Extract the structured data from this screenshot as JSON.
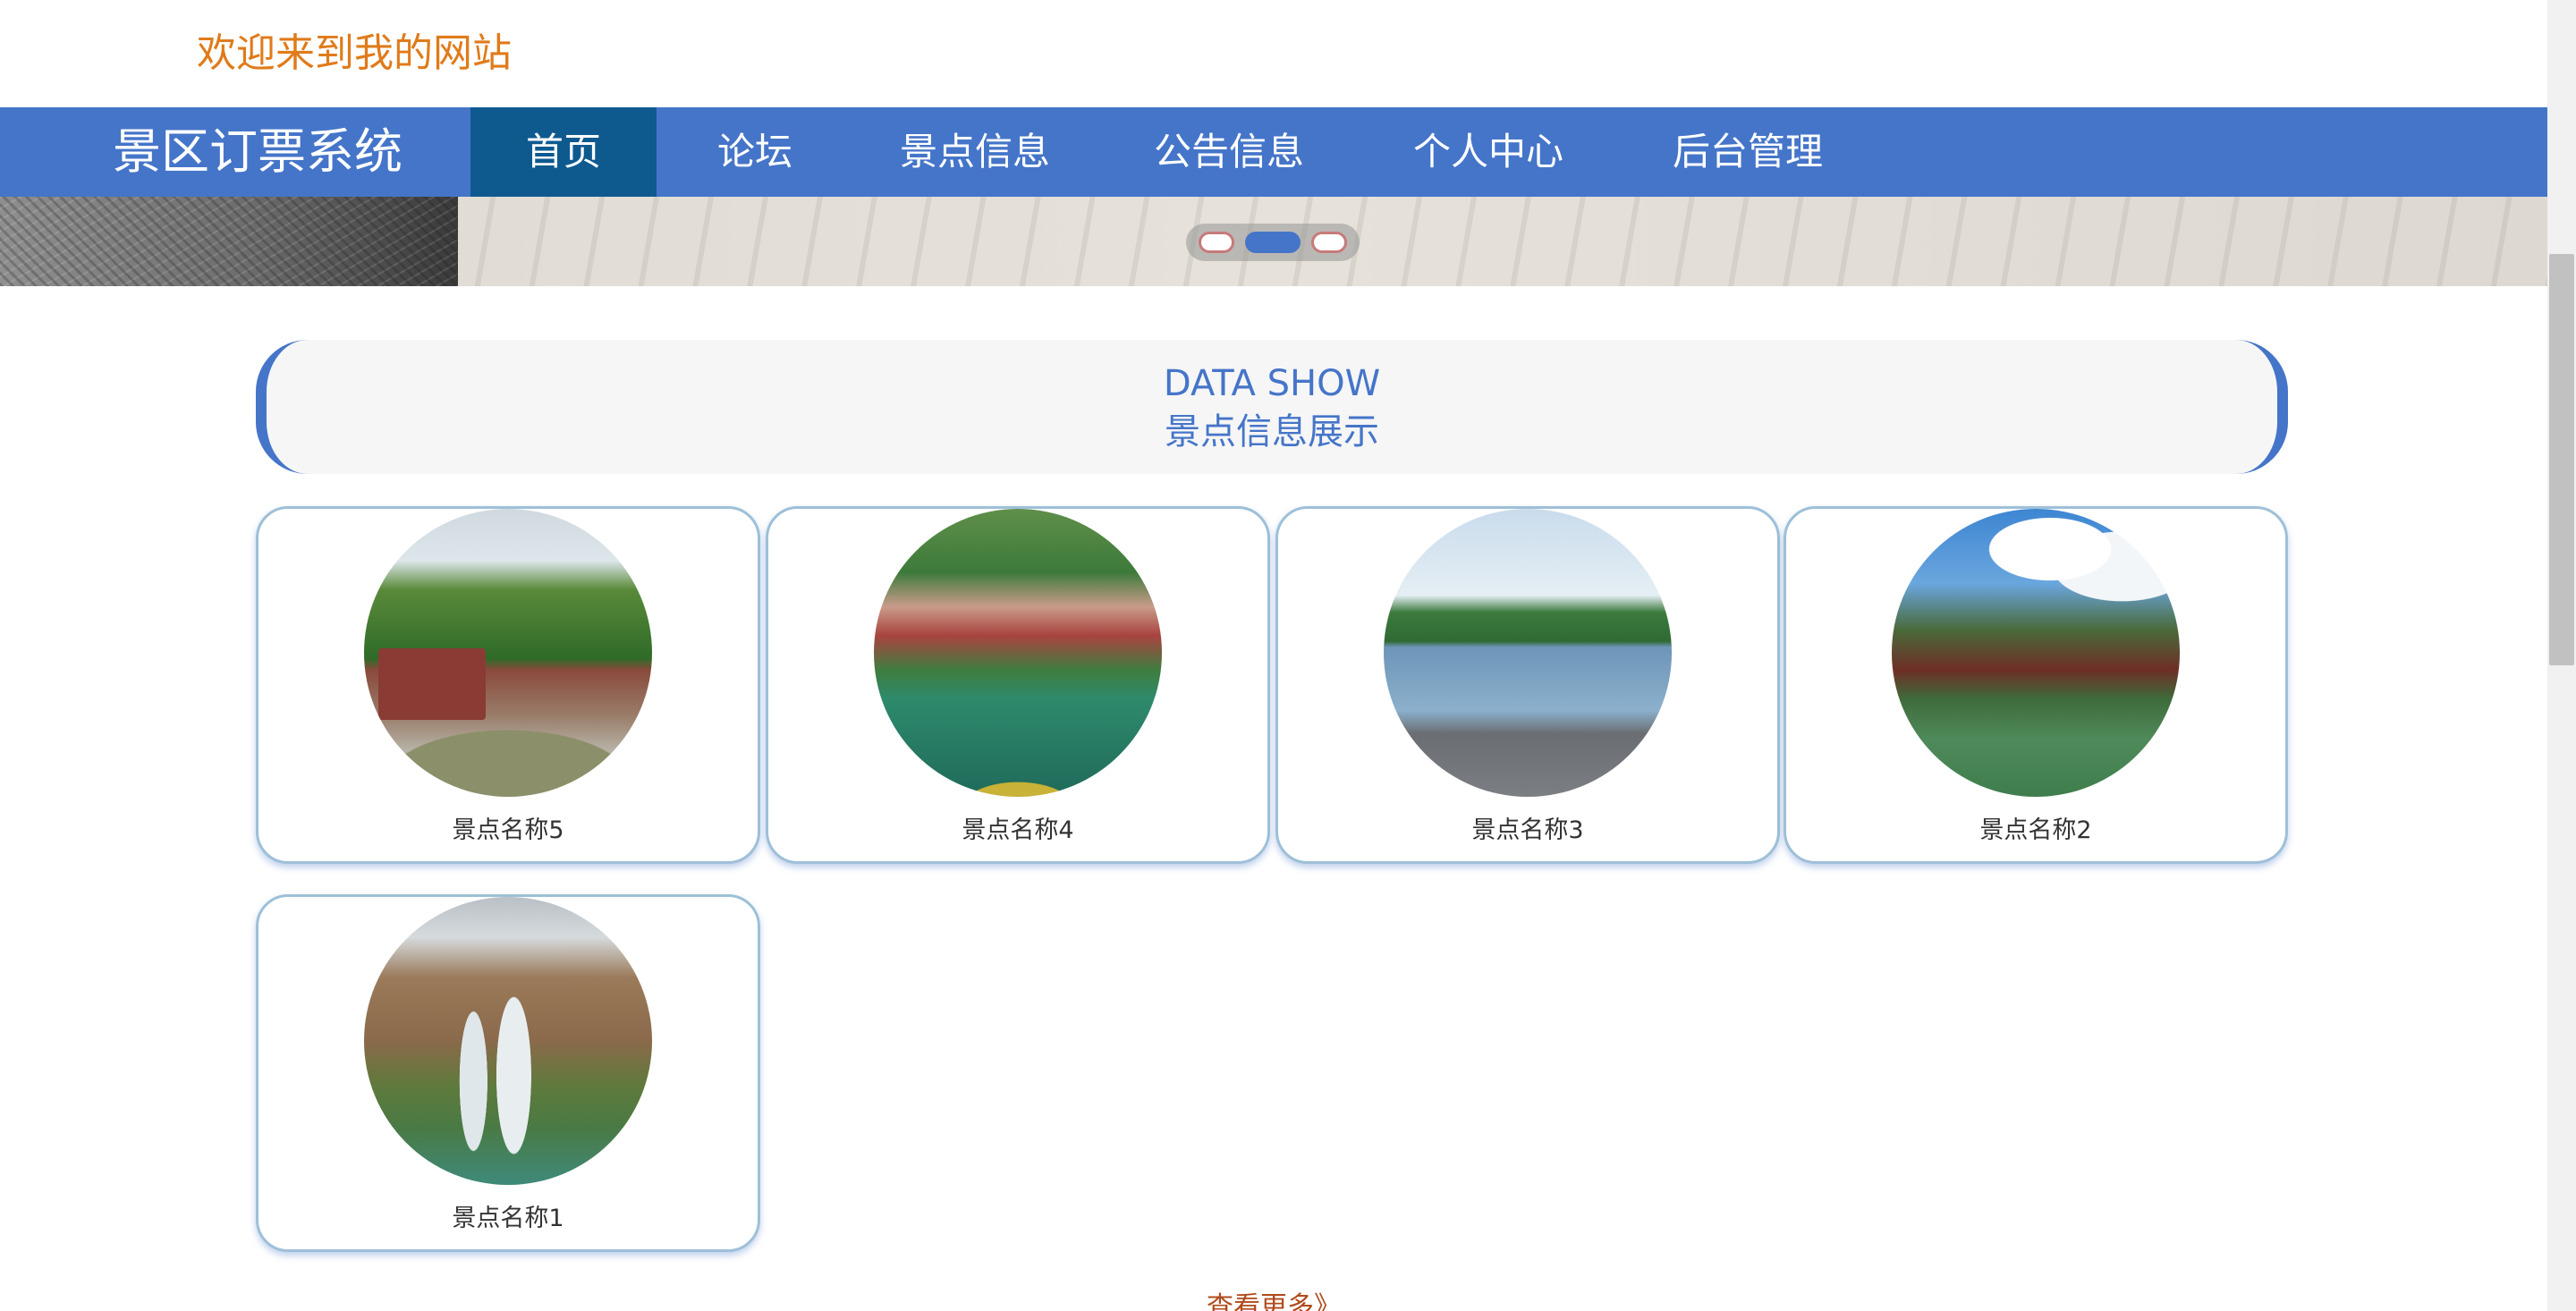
{
  "welcome_text": "欢迎来到我的网站",
  "nav": {
    "brand": "景区订票系统",
    "items": [
      {
        "label": "首页",
        "active": true
      },
      {
        "label": "论坛",
        "active": false
      },
      {
        "label": "景点信息",
        "active": false
      },
      {
        "label": "公告信息",
        "active": false
      },
      {
        "label": "个人中心",
        "active": false
      },
      {
        "label": "后台管理",
        "active": false
      }
    ]
  },
  "carousel": {
    "slide_count": 3,
    "active_index": 1
  },
  "section": {
    "title_en": "DATA SHOW",
    "title_cn": "景点信息展示"
  },
  "cards": [
    {
      "name": "景点名称5"
    },
    {
      "name": "景点名称4"
    },
    {
      "name": "景点名称3"
    },
    {
      "name": "景点名称2"
    },
    {
      "name": "景点名称1"
    }
  ],
  "more_link": "查看更多》",
  "colors": {
    "nav_bg": "#4575c9",
    "nav_active_bg": "#0e5a8f",
    "welcome_text": "#e07b1a",
    "accent": "#4575c9",
    "more_link": "#b04a1a"
  }
}
